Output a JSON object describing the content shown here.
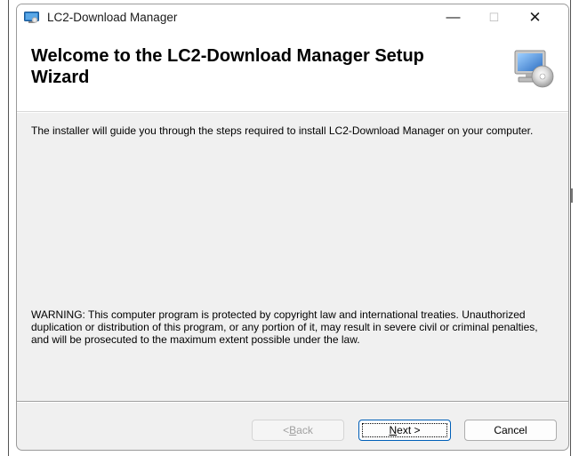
{
  "window": {
    "title": "LC2-Download Manager",
    "controls": {
      "minimize": "—",
      "maximize": "☐",
      "close": "✕"
    }
  },
  "header": {
    "title": "Welcome to the LC2-Download Manager Setup Wizard",
    "graphic_icon": "computer-disc-icon"
  },
  "body": {
    "intro": "The installer will guide you through the steps required to install LC2-Download Manager on your computer.",
    "warning": "WARNING: This computer program is protected by copyright law and international treaties. Unauthorized duplication or distribution of this program, or any portion of it, may result in severe civil or criminal penalties, and will be prosecuted to the maximum extent possible under the law."
  },
  "buttons": {
    "back": {
      "prefix": "< ",
      "mnemonic": "B",
      "rest": "ack",
      "enabled": false
    },
    "next": {
      "prefix": "",
      "mnemonic": "N",
      "rest": "ext >",
      "enabled": true
    },
    "cancel": {
      "label": "Cancel",
      "enabled": true
    }
  },
  "colors": {
    "dialog_background": "#f0f0f0",
    "header_background": "#ffffff",
    "default_button_border": "#005fb8"
  }
}
